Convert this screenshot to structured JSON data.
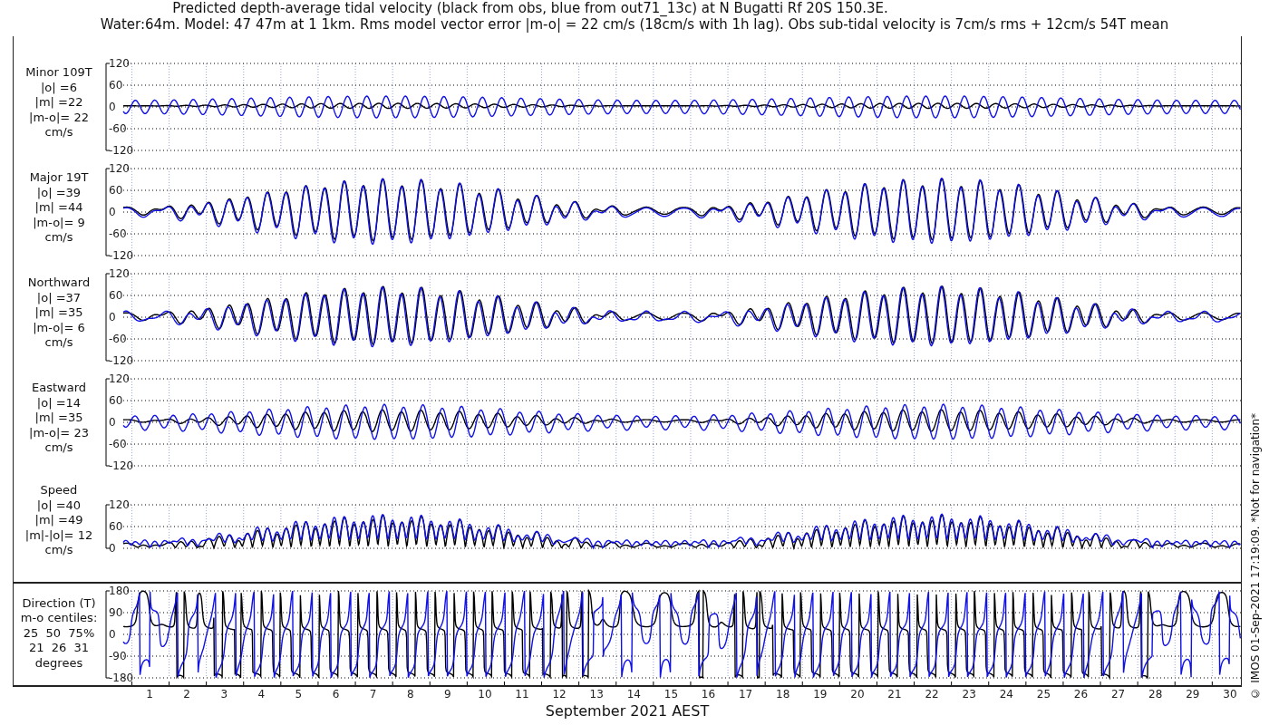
{
  "title_lines": [
    "Predicted depth-average tidal velocity (black from obs, blue from out71_13c) at N Bugatti Rf 20S 150.3E.",
    "Water:64m. Model: 47 47m at 1 1km. Rms model vector error |m-o| = 22 cm/s (18cm/s with 1h lag). Obs sub-tidal velocity is 7cm/s rms + 12cm/s 54T mean"
  ],
  "panels": [
    {
      "kind": "minor",
      "label_lines": [
        "Minor 109T",
        "|o| =6",
        "|m| =22",
        "|m-o|= 22",
        "cm/s"
      ],
      "yticks": [
        "120",
        "60",
        "0",
        "-60",
        "-120"
      ]
    },
    {
      "kind": "major",
      "label_lines": [
        "Major 19T",
        "|o| =39",
        "|m| =44",
        "|m-o|= 9",
        "cm/s"
      ],
      "yticks": [
        "120",
        "60",
        "0",
        "-60",
        "-120"
      ]
    },
    {
      "kind": "northward",
      "label_lines": [
        "Northward",
        "|o| =37",
        "|m| =35",
        "|m-o|= 6",
        "cm/s"
      ],
      "yticks": [
        "120",
        "60",
        "0",
        "-60",
        "-120"
      ]
    },
    {
      "kind": "eastward",
      "label_lines": [
        "Eastward",
        "|o| =14",
        "|m| =35",
        "|m-o|= 23",
        "cm/s"
      ],
      "yticks": [
        "120",
        "60",
        "0",
        "-60",
        "-120"
      ]
    },
    {
      "kind": "speed",
      "label_lines": [
        "Speed",
        "|o| =40",
        "|m| =49",
        "|m|-|o|= 12",
        "cm/s"
      ],
      "yticks": [
        "120",
        "60",
        "0"
      ]
    },
    {
      "kind": "direction",
      "label_lines": [
        "Direction (T)",
        "m-o centiles:",
        "25  50  75%",
        "21  26  31",
        "degrees"
      ],
      "yticks": [
        "180",
        "90",
        "0",
        "-90",
        "-180"
      ]
    }
  ],
  "x_axis": {
    "ticks": [
      "1",
      "2",
      "3",
      "4",
      "5",
      "6",
      "7",
      "8",
      "9",
      "10",
      "11",
      "12",
      "13",
      "14",
      "15",
      "16",
      "17",
      "18",
      "19",
      "20",
      "21",
      "22",
      "23",
      "24",
      "25",
      "26",
      "27",
      "28",
      "29",
      "30"
    ],
    "label": "September 2021 AEST"
  },
  "footnote": "© IMOS 01-Sep-2021 17:19:09. *Not for navigation*"
}
